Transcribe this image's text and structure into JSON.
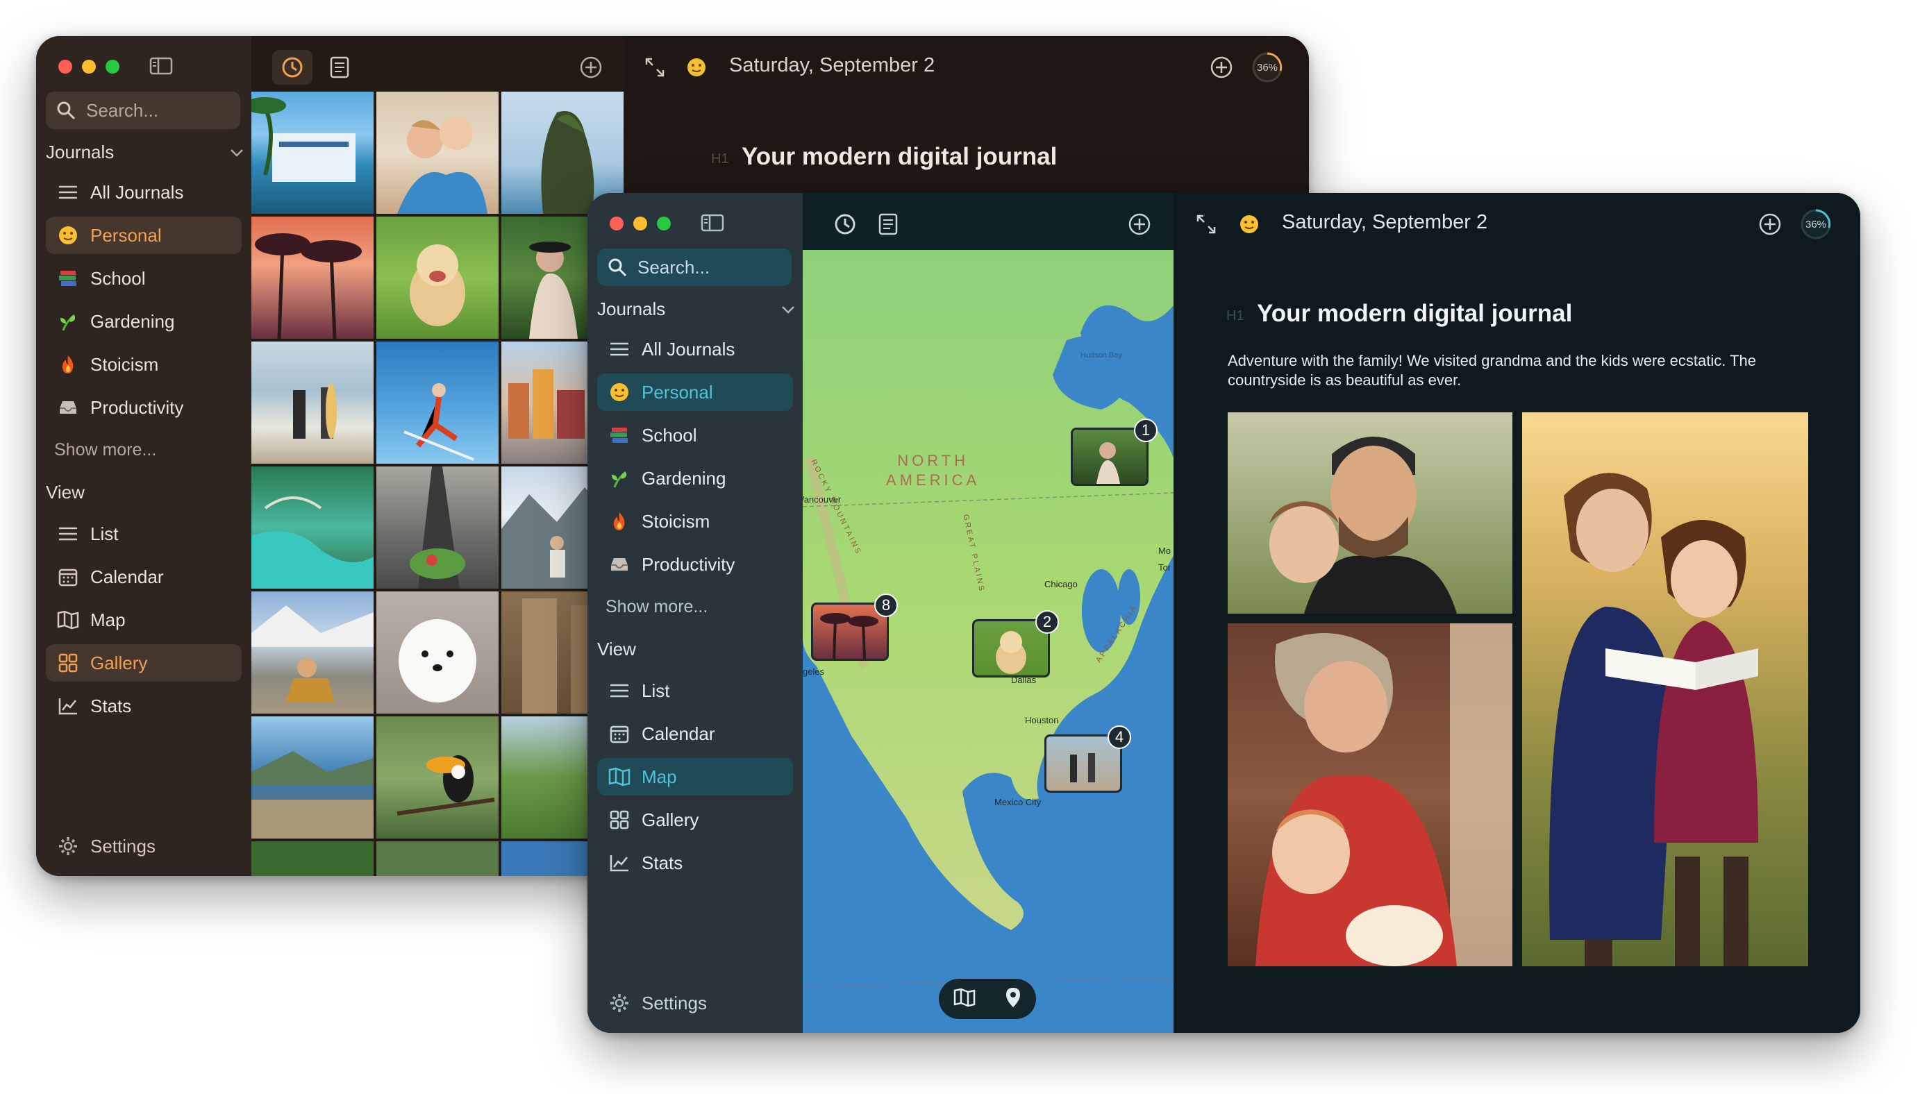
{
  "back_window": {
    "search_placeholder": "Search...",
    "journals_heading": "Journals",
    "journals": [
      {
        "label": "All Journals",
        "icon": "list-icon"
      },
      {
        "label": "Personal",
        "icon": "smiley-icon",
        "selected": true
      },
      {
        "label": "School",
        "icon": "books-icon"
      },
      {
        "label": "Gardening",
        "icon": "sprout-icon"
      },
      {
        "label": "Stoicism",
        "icon": "fire-icon"
      },
      {
        "label": "Productivity",
        "icon": "inbox-icon"
      }
    ],
    "show_more": "Show more...",
    "view_heading": "View",
    "views": [
      {
        "label": "List",
        "icon": "list-icon"
      },
      {
        "label": "Calendar",
        "icon": "calendar-icon"
      },
      {
        "label": "Map",
        "icon": "map-icon"
      },
      {
        "label": "Gallery",
        "icon": "gallery-icon",
        "selected": true
      },
      {
        "label": "Stats",
        "icon": "stats-icon"
      }
    ],
    "settings": "Settings",
    "date": "Saturday, September 2",
    "progress": "36%",
    "heading_marker": "H1",
    "entry_title": "Your modern digital journal",
    "colors": {
      "sidebar": "#2e2420",
      "selected": "#45362e",
      "accent": "#f0a050",
      "editor": "#1e1714"
    }
  },
  "front_window": {
    "search_placeholder": "Search...",
    "journals_heading": "Journals",
    "journals": [
      {
        "label": "All Journals",
        "icon": "list-icon"
      },
      {
        "label": "Personal",
        "icon": "smiley-icon",
        "selected": true
      },
      {
        "label": "School",
        "icon": "books-icon"
      },
      {
        "label": "Gardening",
        "icon": "sprout-icon"
      },
      {
        "label": "Stoicism",
        "icon": "fire-icon"
      },
      {
        "label": "Productivity",
        "icon": "inbox-icon"
      }
    ],
    "show_more": "Show more...",
    "view_heading": "View",
    "views": [
      {
        "label": "List",
        "icon": "list-icon"
      },
      {
        "label": "Calendar",
        "icon": "calendar-icon"
      },
      {
        "label": "Map",
        "icon": "map-icon",
        "selected": true
      },
      {
        "label": "Gallery",
        "icon": "gallery-icon"
      },
      {
        "label": "Stats",
        "icon": "stats-icon"
      }
    ],
    "settings": "Settings",
    "date": "Saturday, September 2",
    "progress": "36%",
    "heading_marker": "H1",
    "entry_title": "Your modern digital journal",
    "entry_body": "Adventure with the family! We visited grandma and the kids were ecstatic. The countryside is as beautiful as ever.",
    "map_labels": {
      "continent_line1": "NORTH",
      "continent_line2": "AMERICA",
      "hudson": "Hudson Bay",
      "chicago": "Chicago",
      "dallas": "Dallas",
      "houston": "Houston",
      "mexico_city": "Mexico City",
      "vancouver": "Vancouver",
      "angeles": "geles",
      "rocky": "ROCKY MOUNTAINS",
      "plains": "GREAT PLAINS",
      "appalachia": "APPALACHIA",
      "mo": "Mo",
      "tor": "Tor"
    },
    "map_pins": [
      "1",
      "8",
      "2",
      "4"
    ],
    "colors": {
      "sidebar": "#29353b",
      "selected": "#1f4a56",
      "accent": "#4fc3d6",
      "editor": "#0f1a1e"
    }
  }
}
